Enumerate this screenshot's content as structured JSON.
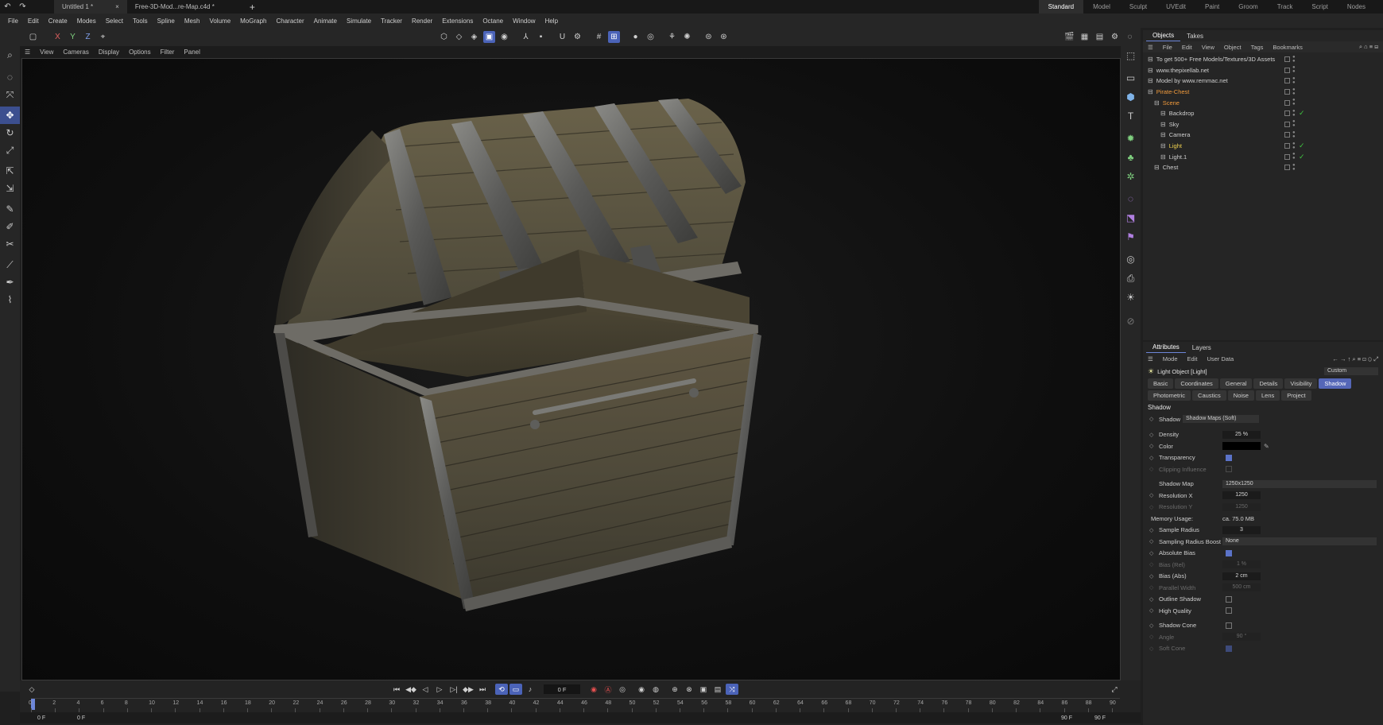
{
  "topbar": {
    "tabs": [
      {
        "label": "Untitled 1 *",
        "active": true
      },
      {
        "label": "Free-3D-Mod...re-Map.c4d *",
        "active": false
      }
    ],
    "layouts": [
      "Standard",
      "Model",
      "Sculpt",
      "UVEdit",
      "Paint",
      "Groom",
      "Track",
      "Script",
      "Nodes"
    ],
    "active_layout": "Standard"
  },
  "menubar": {
    "items": [
      "File",
      "Edit",
      "Create",
      "Modes",
      "Select",
      "Tools",
      "Spline",
      "Mesh",
      "Volume",
      "MoGraph",
      "Character",
      "Animate",
      "Simulate",
      "Tracker",
      "Render",
      "Extensions",
      "Octane",
      "Window",
      "Help"
    ]
  },
  "toolbar": {
    "axes": [
      "X",
      "Y",
      "Z"
    ]
  },
  "viewport": {
    "menu": [
      "View",
      "Cameras",
      "Display",
      "Options",
      "Filter",
      "Panel"
    ]
  },
  "objects": {
    "tabs": [
      "Objects",
      "Takes"
    ],
    "menu": [
      "File",
      "Edit",
      "View",
      "Object",
      "Tags",
      "Bookmarks"
    ],
    "rows": [
      {
        "label": "To get 500+ Free Models/Textures/3D Assets",
        "indent": 0,
        "color": "normal",
        "tag": false
      },
      {
        "label": "www.thepixellab.net",
        "indent": 0,
        "color": "normal",
        "tag": false
      },
      {
        "label": "Model by www.remmac.net",
        "indent": 0,
        "color": "normal",
        "tag": false
      },
      {
        "label": "Pirate-Chest",
        "indent": 0,
        "color": "orange",
        "tag": false
      },
      {
        "label": "Scene",
        "indent": 1,
        "color": "orange",
        "tag": false
      },
      {
        "label": "Backdrop",
        "indent": 2,
        "color": "normal",
        "tag": true
      },
      {
        "label": "Sky",
        "indent": 2,
        "color": "normal",
        "tag": false
      },
      {
        "label": "Camera",
        "indent": 2,
        "color": "normal",
        "tag": false
      },
      {
        "label": "Light",
        "indent": 2,
        "color": "yellow",
        "tag": true
      },
      {
        "label": "Light.1",
        "indent": 2,
        "color": "normal",
        "tag": true
      },
      {
        "label": "Chest",
        "indent": 1,
        "color": "normal",
        "tag": false
      }
    ]
  },
  "attributes": {
    "tabs": [
      "Attributes",
      "Layers"
    ],
    "menu": [
      "Mode",
      "Edit",
      "User Data"
    ],
    "object_title": "Light Object [Light]",
    "preset": "Custom",
    "tab_row1": [
      {
        "label": "Basic",
        "active": false
      },
      {
        "label": "Coordinates",
        "active": false
      },
      {
        "label": "General",
        "active": false
      },
      {
        "label": "Details",
        "active": false
      },
      {
        "label": "Visibility",
        "active": false
      },
      {
        "label": "Shadow",
        "active": true
      }
    ],
    "tab_row2": [
      "Photometric",
      "Caustics",
      "Noise",
      "Lens",
      "Project"
    ],
    "section": "Shadow",
    "shadow_label": "Shadow",
    "shadow_type": "Shadow Maps (Soft)",
    "density_label": "Density",
    "density": "25 %",
    "color_label": "Color",
    "transparency_label": "Transparency",
    "clipping_label": "Clipping Influence",
    "shadow_map_label": "Shadow Map",
    "shadow_map": "1250x1250",
    "res_x_label": "Resolution X",
    "res_x": "1250",
    "res_y_label": "Resolution Y",
    "res_y": "1250",
    "memory_label": "Memory Usage:",
    "memory": "ca. 75.0 MB",
    "sample_radius_label": "Sample Radius",
    "sample_radius": "3",
    "boost_label": "Sampling Radius Boost",
    "boost": "None",
    "absolute_bias_label": "Absolute Bias",
    "bias_rel_label": "Bias (Rel)",
    "bias_rel": "1 %",
    "bias_abs_label": "Bias (Abs)",
    "bias_abs": "2 cm",
    "parallel_label": "Parallel Width",
    "parallel": "500 cm",
    "outline_label": "Outline Shadow",
    "hq_label": "High Quality",
    "cone_label": "Shadow Cone",
    "angle_label": "Angle",
    "angle": "90 °",
    "soft_cone_label": "Soft Cone"
  },
  "timeline": {
    "current_frame": "0 F",
    "ticks": [
      "0",
      "2",
      "4",
      "6",
      "8",
      "10",
      "12",
      "14",
      "16",
      "18",
      "20",
      "22",
      "24",
      "26",
      "28",
      "30",
      "32",
      "34",
      "36",
      "38",
      "40",
      "42",
      "44",
      "46",
      "48",
      "50",
      "52",
      "54",
      "56",
      "58",
      "60",
      "62",
      "64",
      "66",
      "68",
      "70",
      "72",
      "74",
      "76",
      "78",
      "80",
      "82",
      "84",
      "86",
      "88",
      "90"
    ],
    "start": "0 F",
    "start2": "0 F",
    "end": "90 F",
    "end2": "90 F"
  },
  "colors": {
    "accent": "#4b63b8",
    "orange_label": "#f09a3c",
    "yellow_label": "#f1d250",
    "tag_green": "#3fc43f"
  }
}
